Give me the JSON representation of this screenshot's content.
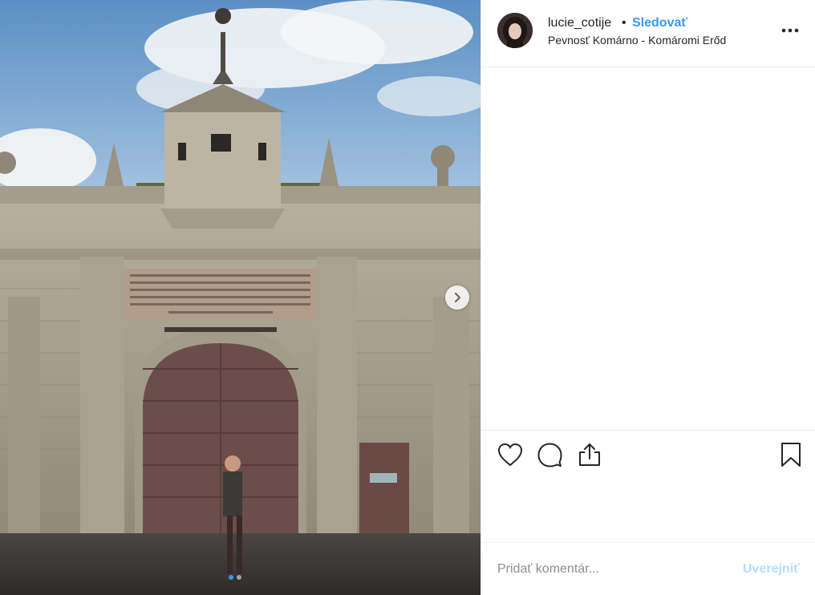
{
  "post": {
    "photo_alt": "fortress gate",
    "inscription": "LEOPOLDI ROMA IMP HVNG ARCHID AVSTRIAE GVBERNATORE CAROLO LOTHARINGIAE DVCE ANNO MDCLXXIII",
    "carousel": {
      "count": 2,
      "active_index": 0
    }
  },
  "header": {
    "username": "lucie_cotije",
    "separator": "•",
    "follow_label": "Sledovať",
    "location": "Pevnosť Komárno - Komáromi Erőd"
  },
  "icons": {
    "like": "heart-icon",
    "comment": "comment-icon",
    "share": "share-icon",
    "save": "bookmark-icon",
    "more": "more-options-icon",
    "next": "chevron-right-icon"
  },
  "comment": {
    "placeholder": "Pridať komentár...",
    "post_label": "Uverejniť"
  },
  "colors": {
    "accent": "#3897f0",
    "post_disabled": "#b2dffc",
    "text": "#262626",
    "muted": "#8e8e8e"
  }
}
